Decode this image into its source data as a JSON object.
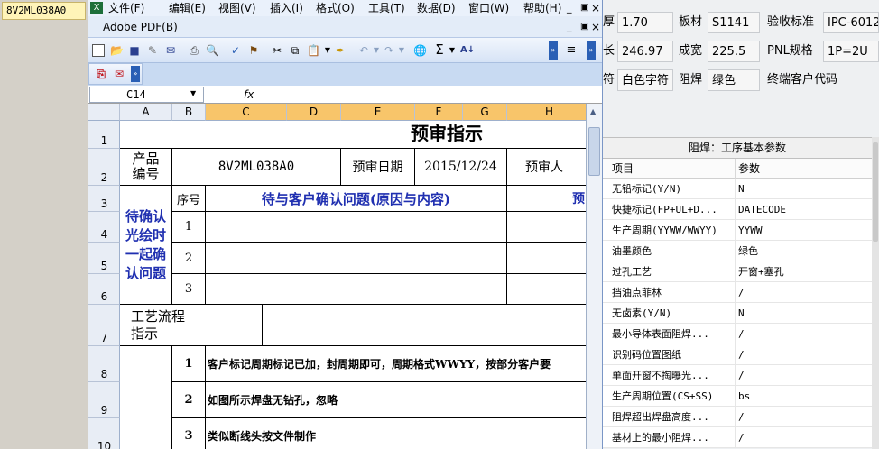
{
  "left_tag": "8V2ML038A0",
  "right_panel": {
    "top_fields": [
      {
        "text": "厚"
      },
      {
        "text": "1.70"
      },
      {
        "text": "板材"
      },
      {
        "text": "S1141"
      },
      {
        "text": "验收标准"
      },
      {
        "text": "IPC-6012"
      },
      {
        "text": "长"
      },
      {
        "text": "246.97"
      },
      {
        "text": "成宽"
      },
      {
        "text": "225.5"
      },
      {
        "text": "PNL规格"
      },
      {
        "text": "1P=2U"
      },
      {
        "text": "符"
      },
      {
        "text": "白色字符"
      },
      {
        "text": "阻焊"
      },
      {
        "text": "绿色"
      },
      {
        "text": "终端客户代码"
      }
    ],
    "title": "阻焊：工序基本参数",
    "col_item": "项目",
    "col_param": "参数",
    "rows": [
      {
        "key": "无铅标记(Y/N)",
        "val": "N"
      },
      {
        "key": "快捷标记(FP+UL+D...",
        "val": "DATECODE"
      },
      {
        "key": "生产周期(YYWW/WWYY)",
        "val": "YYWW"
      },
      {
        "key": "油墨颜色",
        "val": "绿色"
      },
      {
        "key": "过孔工艺",
        "val": "开窗+塞孔"
      },
      {
        "key": "挡油点菲林",
        "val": "/"
      },
      {
        "key": "无卤素(Y/N)",
        "val": "N"
      },
      {
        "key": "最小导体表面阻焊...",
        "val": "/"
      },
      {
        "key": "识别码位置图纸",
        "val": "/"
      },
      {
        "key": "单面开窗不掏曝光...",
        "val": "/"
      },
      {
        "key": "生产周期位置(CS+SS)",
        "val": "bs"
      },
      {
        "key": "阻焊超出焊盘高度...",
        "val": "/"
      },
      {
        "key": "基材上的最小阻焊...",
        "val": "/"
      }
    ]
  },
  "excel": {
    "menu": [
      "文件(F)",
      "编辑(E)",
      "视图(V)",
      "插入(I)",
      "格式(O)",
      "工具(T)",
      "数据(D)",
      "窗口(W)",
      "帮助(H)"
    ],
    "pdf_menu": "Adobe PDF(B)",
    "name_box": "C14",
    "fx": "fx",
    "columns": [
      "A",
      "B",
      "C",
      "D",
      "E",
      "F",
      "G",
      "H"
    ],
    "rows": [
      "1",
      "2",
      "3",
      "4",
      "5",
      "6",
      "7",
      "8",
      "9",
      "10"
    ],
    "cells": {
      "title": "预审指示",
      "product_no_label": "产品\n编号",
      "product_no": "8V2ML038A0",
      "review_date_label": "预审日期",
      "review_date": "2015/12/24",
      "reviewer_label": "预审人",
      "seq_label": "序号",
      "pending_header": "待与客户确认问题(原因与内容)",
      "pending_header_right": "预",
      "pending_label": "待确认\n光绘时\n一起确\n认问题",
      "n1": "1",
      "n2": "2",
      "n3": "3",
      "process_label": "工艺流程\n指示",
      "p1_no": "1",
      "p1": "客户标记周期标记已加，封周期即可，周期格式WWYY，按部分客户要",
      "p2_no": "2",
      "p2": "如图所示焊盘无钻孔，忽略",
      "p3_no": "3",
      "p3": "类似断线头按文件制作"
    }
  }
}
